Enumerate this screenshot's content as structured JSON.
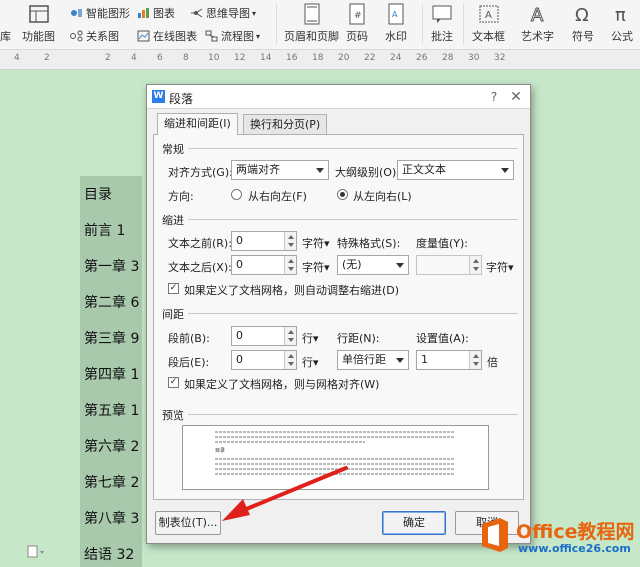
{
  "ribbon": {
    "left_cut_1": "库",
    "left_cut_2": "功能图",
    "smart_graphic": "智能图形",
    "chart": "图表",
    "mindmap": "思维导图",
    "relation": "关系图",
    "online_chart": "在线图表",
    "flowchart": "流程图",
    "header_footer": "页眉和页脚",
    "page_number": "页码",
    "watermark": "水印",
    "comment": "批注",
    "textbox": "文本框",
    "wordart": "艺术字",
    "symbol": "符号",
    "formula": "公式"
  },
  "ruler": {
    "marks": [
      "4",
      "2",
      "2",
      "4",
      "6",
      "8",
      "10",
      "12",
      "14",
      "16",
      "18",
      "20",
      "22",
      "24",
      "26",
      "28",
      "30",
      "32"
    ]
  },
  "document": {
    "lines": [
      "目录",
      "前言 1",
      "第一章 3",
      "第二章 6",
      "第三章 9",
      "第四章 1",
      "第五章 1",
      "第六章 2",
      "第七章 2",
      "第八章 3",
      "结语 32"
    ]
  },
  "dialog": {
    "title": "段落",
    "tabs": [
      "缩进和间距(I)",
      "换行和分页(P)"
    ],
    "general": {
      "heading": "常规",
      "align_label": "对齐方式(G):",
      "align_value": "两端对齐",
      "outline_label": "大纲级别(O):",
      "outline_value": "正文文本",
      "direction_label": "方向:",
      "rtl_label": "从右向左(F)",
      "ltr_label": "从左向右(L)"
    },
    "indent": {
      "heading": "缩进",
      "before_label": "文本之前(R):",
      "before_value": "0",
      "before_unit": "字符▾",
      "after_label": "文本之后(X):",
      "after_value": "0",
      "after_unit": "字符▾",
      "special_label": "特殊格式(S):",
      "special_value": "(无)",
      "measure_label": "度量值(Y):",
      "measure_unit": "字符▾",
      "grid_check": "如果定义了文档网格，则自动调整右缩进(D)"
    },
    "spacing": {
      "heading": "间距",
      "before_label": "段前(B):",
      "before_value": "0",
      "before_unit": "行▾",
      "after_label": "段后(E):",
      "after_value": "0",
      "after_unit": "行▾",
      "line_label": "行距(N):",
      "line_value": "单倍行距",
      "setting_label": "设置值(A):",
      "setting_value": "1",
      "setting_unit": "倍",
      "grid_check": "如果定义了文档网格，则与网格对齐(W)"
    },
    "preview": {
      "heading": "预览",
      "sample_text": "目录"
    },
    "buttons": {
      "tabs": "制表位(T)...",
      "ok": "确定",
      "cancel": "取消"
    }
  },
  "watermark": {
    "brand": "Office教程网",
    "url": "www.office26.com"
  },
  "colors": {
    "accent_arrow": "#e0201b",
    "doc_background": "#c6e8c9",
    "brand_orange": "#e8650f"
  }
}
